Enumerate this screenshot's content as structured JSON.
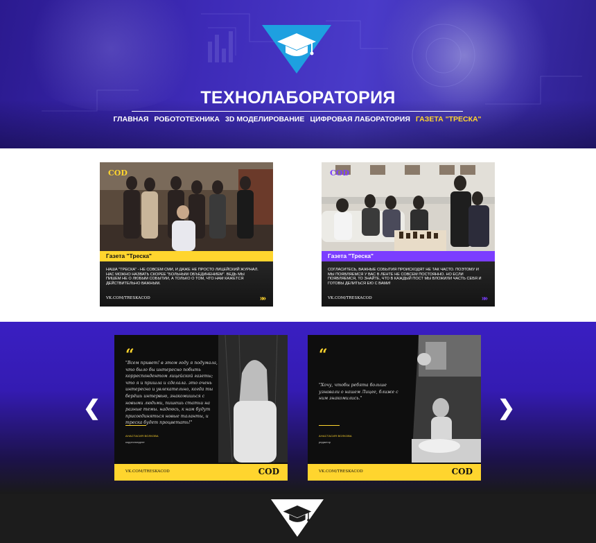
{
  "site": {
    "title": "ТЕХНОЛАБОРАТОРИЯ",
    "logo_icon": "graduation-cap-icon",
    "accent_color": "#ffd52e",
    "logo_color": "#1ea0e0"
  },
  "nav": {
    "items": [
      {
        "label": "ГЛАВНАЯ"
      },
      {
        "label": "РОБОТОТЕХНИКА"
      },
      {
        "label": "3D МОДЕЛИРОВАНИЕ"
      },
      {
        "label": "ЦИФРОВАЯ ЛАБОРАТОРИЯ"
      },
      {
        "label": "ГАЗЕТА \"ТРЕСКА\"",
        "active": true
      }
    ]
  },
  "posts": [
    {
      "brand": "COD",
      "tag": "Газета \"Треска\"",
      "tag_color": "#ffd52e",
      "text": "НАША \"ТРЕСКА\" - НЕ СОВСЕМ СМИ, И ДАЖЕ НЕ ПРОСТО ЛИЦЕЙСКИЙ ЖУРНАЛ. НАС МОЖНО НАЗВАТЬ СКОРЕЕ \"БОЛЬНЫМ ОБЪЕДИНЕНИЕМ\". ВЕДЬ МЫ ПИШЕМ НЕ О ЛЮБЫМ СОБЫТИИ, А ТОЛЬКО О ТОМ, ЧТО НАМ КАЖЕТСЯ ДЕЙСТВИТЕЛЬНО ВАЖНЫМ.",
      "link": "VK.COM/TRESKACOD",
      "arrow": "»»"
    },
    {
      "brand": "COD",
      "tag": "Газета \"Треска\"",
      "tag_color": "#7b3dff",
      "text": "СОГЛАСИТЕСЬ, ВАЖНЫЕ СОБЫТИЯ ПРОИСХОДЯТ НЕ ТАК ЧАСТО. ПОЭТОМУ И МЫ ПОЯВЛЯЕМСЯ У ВАС В ЛЕНТЕ НЕ СОВСЕМ ПОСТОЯННО. НО ЕСЛИ ПОЯВЛЯЕМСЯ, ТО ЗНАЙТЕ, ЧТО В КАЖДЫЙ ПОСТ МЫ ВЛОЖИЛИ ЧАСТЬ СЕБЯ И ГОТОВЫ ДЕЛИТЬСЯ ЕЮ С ВАМИ!",
      "link": "VK.COM/TRESKACOD",
      "arrow": "»»"
    }
  ],
  "quotes": [
    {
      "mark": "“",
      "text": "\"Всем привет! в этом году я подумала, что было бы интересно побыть корреспондентом лицейской газеты; что я и пришла и сделала. это очень интересно и увлекательно, когда ты берёшь интервью, знакомишься с новыми людьми, пишешь статьи на разные темы. надеюсь, к нам будут присоединяться новые таланты, и треска будет процветать!\"",
      "name": "АНАСТАСИЯ ВОЛКОВА",
      "role": "корреспондент",
      "link": "VK.COM/TRESKACOD",
      "brand": "COD"
    },
    {
      "mark": "“",
      "text": "\"Хочу, чтобы ребята больше узнавали о нашем Лицее, ближе с ним знакомились.\"",
      "name": "АНАСТАСИЯ ВОЛКОВА",
      "role": "редактор",
      "link": "VK.COM/TRESKACOD",
      "brand": "COD"
    }
  ],
  "slider": {
    "prev_icon": "chevron-left-icon",
    "next_icon": "chevron-right-icon",
    "prev": "❮",
    "next": "❯"
  },
  "footer": {
    "logo_icon": "graduation-cap-icon"
  }
}
